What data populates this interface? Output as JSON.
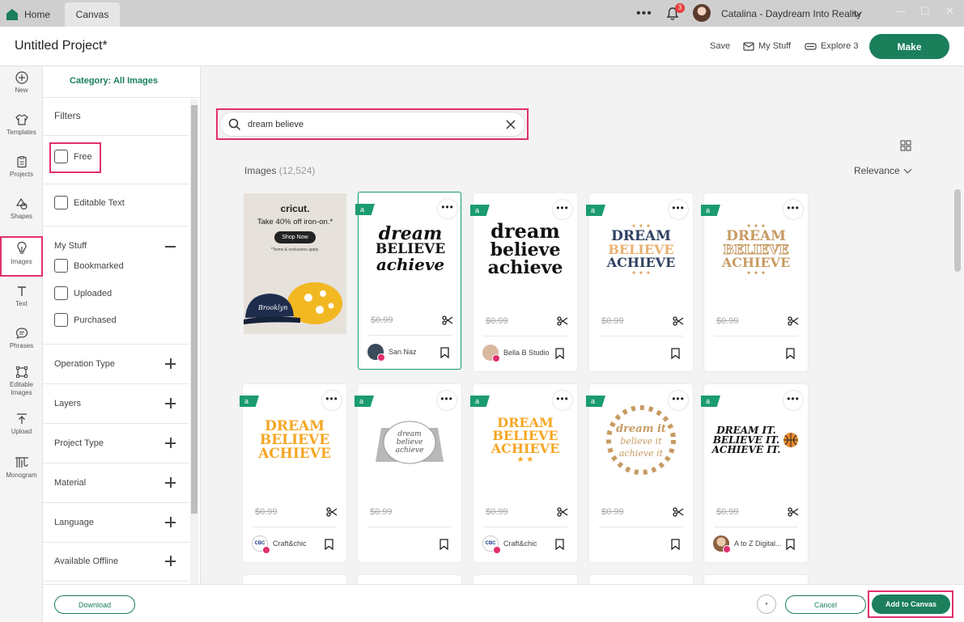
{
  "titlebar": {
    "home_label": "Home",
    "canvas_label": "Canvas",
    "more_label": "•••",
    "notification_count": "3",
    "user_name": "Catalina - Daydream Into Reality"
  },
  "header": {
    "project_title": "Untitled Project*",
    "save_label": "Save",
    "my_stuff_label": "My Stuff",
    "explore_label": "Explore 3",
    "make_label": "Make"
  },
  "rail": {
    "items": [
      {
        "label": "New",
        "icon": "plus-circle-icon"
      },
      {
        "label": "Templates",
        "icon": "shirt-icon"
      },
      {
        "label": "Projects",
        "icon": "clipboard-icon"
      },
      {
        "label": "Shapes",
        "icon": "shapes-icon"
      },
      {
        "label": "Images",
        "icon": "lightbulb-icon"
      },
      {
        "label": "Text",
        "icon": "text-icon"
      },
      {
        "label": "Phrases",
        "icon": "speech-bubble-icon"
      },
      {
        "label": "Editable Images",
        "icon": "editable-image-icon"
      },
      {
        "label": "Upload",
        "icon": "upload-icon"
      },
      {
        "label": "Monogram",
        "icon": "monogram-icon"
      }
    ],
    "active": "Images"
  },
  "filters": {
    "category": "Category: All Images",
    "heading": "Filters",
    "free_label": "Free",
    "editable_text_label": "Editable Text",
    "my_stuff_heading": "My Stuff",
    "bookmarked_label": "Bookmarked",
    "uploaded_label": "Uploaded",
    "purchased_label": "Purchased",
    "sections": [
      "Operation Type",
      "Layers",
      "Project Type",
      "Material",
      "Language",
      "Available Offline"
    ]
  },
  "search": {
    "value": "dream believe",
    "results_label": "Images",
    "results_count": "(12,524)",
    "sort_label": "Relevance"
  },
  "ad": {
    "logo": "cricut.",
    "headline": "Take 40% off iron-on.*",
    "button": "Shop Now",
    "fine_print": "*Terms & exclusions apply."
  },
  "cards": [
    {
      "design": [
        "dream",
        "BELIEVE",
        "achieve"
      ],
      "style": "black-script",
      "price": "$0.99",
      "designer": "San Naz",
      "selected": true
    },
    {
      "design": [
        "dream",
        "believe",
        "achieve"
      ],
      "style": "black-bold",
      "price": "$0.99",
      "designer": "Bella B Studio",
      "selected": false
    },
    {
      "design": [
        "DREAM",
        "BELIEVE",
        "ACHIEVE"
      ],
      "style": "navy",
      "price": "$0.99",
      "designer": "",
      "selected": false
    },
    {
      "design": [
        "DREAM",
        "BELIEVE",
        "ACHIEVE"
      ],
      "style": "tan",
      "price": "$0.99",
      "designer": "",
      "selected": false
    },
    {
      "design": [
        "DREAM",
        "BELIEVE",
        "ACHIEVE"
      ],
      "style": "orange",
      "price": "$0.99",
      "designer": "Craft&chic",
      "selected": false
    },
    {
      "design": [
        "dream",
        "believe",
        "achieve"
      ],
      "style": "cake",
      "price": "$0.99",
      "designer": "",
      "selected": false
    },
    {
      "design": [
        "DREAM",
        "BELIEVE",
        "ACHIEVE"
      ],
      "style": "orange-stars",
      "price": "$0.99",
      "designer": "Craft&chic",
      "selected": false
    },
    {
      "design": [
        "dream it",
        "believe it",
        "achieve it"
      ],
      "style": "tan-circle",
      "price": "$0.99",
      "designer": "",
      "selected": false
    },
    {
      "design": [
        "DREAM IT.",
        "BELIEVE IT.",
        "ACHIEVE IT."
      ],
      "style": "black-ball",
      "price": "$0.99",
      "designer": "A to Z Digital...",
      "selected": false
    }
  ],
  "footer": {
    "download_label": "Download",
    "cancel_label": "Cancel",
    "add_label": "Add to Canvas"
  },
  "colors": {
    "brand_green": "#1b7f5b",
    "highlight_pink": "#e0306e",
    "badge_green": "#1b9b72"
  }
}
